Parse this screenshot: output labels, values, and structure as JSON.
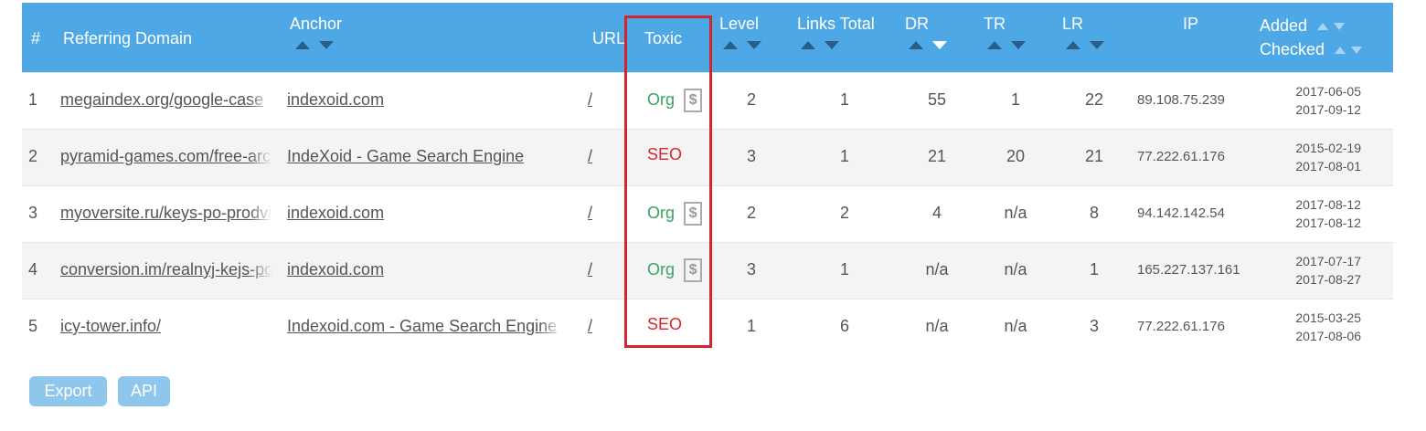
{
  "headers": {
    "num": "#",
    "domain": "Referring Domain",
    "anchor": "Anchor",
    "url": "URL",
    "toxic": "Toxic",
    "level": "Level",
    "links_total": "Links Total",
    "dr": "DR",
    "tr": "TR",
    "lr": "LR",
    "ip": "IP",
    "added": "Added",
    "checked": "Checked"
  },
  "rows": [
    {
      "num": "1",
      "domain": "megaindex.org/google-case",
      "anchor": "indexoid.com",
      "url": "/",
      "toxic": "Org",
      "paid": true,
      "level": "2",
      "links": "1",
      "dr": "55",
      "tr": "1",
      "lr": "22",
      "ip": "89.108.75.239",
      "added": "2017-06-05",
      "checked": "2017-09-12"
    },
    {
      "num": "2",
      "domain": "pyramid-games.com/free-arcade",
      "anchor": "IndeXoid - Game Search Engine",
      "url": "/",
      "toxic": "SEO",
      "paid": false,
      "level": "3",
      "links": "1",
      "dr": "21",
      "tr": "20",
      "lr": "21",
      "ip": "77.222.61.176",
      "added": "2015-02-19",
      "checked": "2017-08-01"
    },
    {
      "num": "3",
      "domain": "myoversite.ru/keys-po-prodvizheniyu",
      "anchor": "indexoid.com",
      "url": "/",
      "toxic": "Org",
      "paid": true,
      "level": "2",
      "links": "2",
      "dr": "4",
      "tr": "n/a",
      "lr": "8",
      "ip": "94.142.142.54",
      "added": "2017-08-12",
      "checked": "2017-08-12"
    },
    {
      "num": "4",
      "domain": "conversion.im/realnyj-kejs-po",
      "anchor": "indexoid.com",
      "url": "/",
      "toxic": "Org",
      "paid": true,
      "level": "3",
      "links": "1",
      "dr": "n/a",
      "tr": "n/a",
      "lr": "1",
      "ip": "165.227.137.161",
      "added": "2017-07-17",
      "checked": "2017-08-27"
    },
    {
      "num": "5",
      "domain": "icy-tower.info/",
      "anchor": "Indexoid.com - Game Search Engine",
      "url": "/",
      "toxic": "SEO",
      "paid": false,
      "level": "1",
      "links": "6",
      "dr": "n/a",
      "tr": "n/a",
      "lr": "3",
      "ip": "77.222.61.176",
      "added": "2015-03-25",
      "checked": "2017-08-06"
    }
  ],
  "buttons": {
    "export": "Export",
    "api": "API"
  },
  "icons": {
    "paid": "dollar-icon",
    "sort_up": "sort-asc-icon",
    "sort_down": "sort-desc-icon"
  },
  "colors": {
    "header_bg": "#4ea8e6",
    "org": "#3aa361",
    "seo": "#d8262d",
    "highlight": "#d4252c",
    "button_bg": "#8fc6ec"
  },
  "sort": {
    "column": "DR",
    "direction": "desc"
  }
}
